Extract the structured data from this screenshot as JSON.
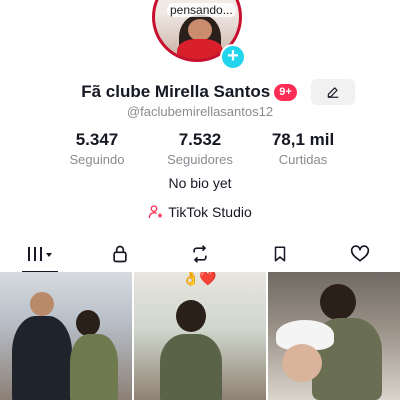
{
  "profile": {
    "avatar_caption": "pensando...",
    "display_name": "Fã clube Mirella Santos",
    "badge": "9+",
    "username": "@faclubemirellasantos12",
    "bio": "No bio yet",
    "studio_label": "TikTok Studio"
  },
  "stats": [
    {
      "value": "5.347",
      "label": "Seguindo"
    },
    {
      "value": "7.532",
      "label": "Seguidores"
    },
    {
      "value": "78,1 mil",
      "label": "Curtidas"
    }
  ],
  "tabs": [
    {
      "icon": "videos-grid-icon",
      "active": true
    },
    {
      "icon": "lock-icon",
      "active": false
    },
    {
      "icon": "repost-icon",
      "active": false
    },
    {
      "icon": "bookmark-icon",
      "active": false
    },
    {
      "icon": "heart-icon",
      "active": false
    }
  ],
  "thumbnail_emojis": "👌❤️",
  "colors": {
    "plus_button": "#20d5ec",
    "badge": "#fe2c55",
    "avatar_ring": "#c8102e",
    "text_primary": "#161823",
    "text_secondary": "#8a8b91"
  }
}
